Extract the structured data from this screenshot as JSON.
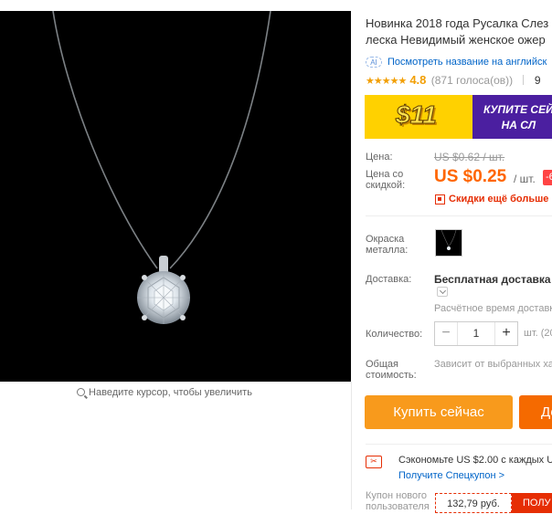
{
  "gallery": {
    "zoom_hint": "Наведите курсор, чтобы увеличить"
  },
  "product": {
    "title_line1": "Новинка 2018 года Русалка Слез",
    "title_line2": "леска Невидимый женское ожер",
    "translate_icon": "AI",
    "translate_link": "Посмотреть название на английск",
    "stars": "★★★★★",
    "rating": "4.8",
    "votes": "(871 голоса(ов))",
    "orders": "9"
  },
  "banner": {
    "amount": "$11",
    "line1": "КУПИТЕ СЕЙ",
    "line2": "НА СЛ"
  },
  "price": {
    "label": "Цена:",
    "old_value": "US $0.62 / шт.",
    "discount_label_1": "Цена со",
    "discount_label_2": "скидкой:",
    "new_value": "US $0.25",
    "unit": "/ шт.",
    "badge": "-6",
    "app_discount": "Скидки ещё больше в"
  },
  "options": {
    "metal_label_1": "Окраска",
    "metal_label_2": "металла:"
  },
  "shipping": {
    "label": "Доставка:",
    "value": "Бесплатная доставка в",
    "estimate": "Расчётное время доставк"
  },
  "quantity": {
    "label": "Количество:",
    "minus": "−",
    "value": "1",
    "plus": "+",
    "unit": "шт. (20"
  },
  "total": {
    "label_1": "Общая",
    "label_2": "стоимость:",
    "value": "Зависит от выбранных ха"
  },
  "actions": {
    "buy": "Купить сейчас",
    "cart": "До"
  },
  "coupon": {
    "icon": "✂",
    "savings": "Сэкономьте US $2.00 с каждых US",
    "link": "Получите Спецкупон >",
    "new_user_1": "Купон нового",
    "new_user_2": "пользователя",
    "amount": "132,79 руб.",
    "get": "ПОЛУ"
  }
}
